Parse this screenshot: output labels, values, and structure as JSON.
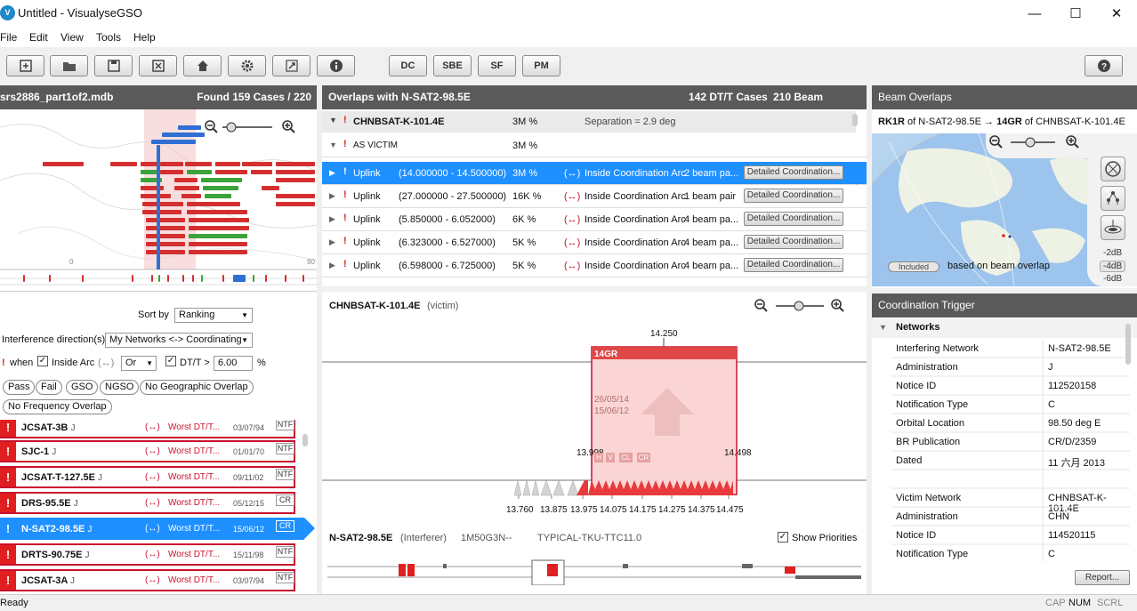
{
  "window": {
    "title": "Untitled - VisualyseGSO",
    "logo_text": "V"
  },
  "menu": [
    "File",
    "Edit",
    "View",
    "Tools",
    "Help"
  ],
  "toolbar": {
    "dc": "DC",
    "sbe": "SBE",
    "sf": "SF",
    "pm": "PM"
  },
  "left": {
    "header_file": "srs2886_part1of2.mdb",
    "header_found": "Found 159 Cases / 220",
    "map_ticks": {
      "t0": "0",
      "t90": "90"
    },
    "sort_label": "Sort by",
    "sort_value": "Ranking",
    "direction_label": "Interference direction(s)",
    "direction_value": "My Networks <-> Coordinating",
    "when_label": "when",
    "inside_arc": "Inside Arc",
    "arrow_sym": "(↔)",
    "or_value": "Or",
    "dt_label": "DT/T >",
    "dt_value": "6.00",
    "pct": "%",
    "pills": [
      "Pass",
      "Fail",
      "GSO",
      "NGSO",
      "No Geographic Overlap",
      "No Frequency Overlap"
    ],
    "cases": [
      {
        "name": "JCSAT-3B",
        "suffix": "J",
        "worst": "Worst DT/T...",
        "date": "03/07/94",
        "tag": "NTF"
      },
      {
        "name": "SJC-1",
        "suffix": "J",
        "worst": "Worst DT/T...",
        "date": "01/01/70",
        "tag": "NTF"
      },
      {
        "name": "JCSAT-T-127.5E",
        "suffix": "J",
        "worst": "Worst DT/T...",
        "date": "09/11/02",
        "tag": "NTF"
      },
      {
        "name": "DRS-95.5E",
        "suffix": "J",
        "worst": "Worst DT/T...",
        "date": "05/12/15",
        "tag": "CR"
      },
      {
        "name": "N-SAT2-98.5E",
        "suffix": "J",
        "worst": "Worst DT/T...",
        "date": "15/06/12",
        "tag": "CR"
      },
      {
        "name": "DRTS-90.75E",
        "suffix": "J",
        "worst": "Worst DT/T...",
        "date": "15/11/98",
        "tag": "NTF"
      },
      {
        "name": "JCSAT-3A",
        "suffix": "J",
        "worst": "Worst DT/T...",
        "date": "03/07/94",
        "tag": "NTF"
      }
    ],
    "excl": "!"
  },
  "mid": {
    "header_title": "Overlaps with N-SAT2-98.5E",
    "header_cases": "142 DT/T Cases",
    "header_beams": "210 Beam Overlaps",
    "group_name": "CHNBSAT-K-101.4E",
    "group_pct": "3M %",
    "group_sep": "Separation = 2.9 deg",
    "victim_label": "AS VICTIM",
    "victim_pct": "3M %",
    "rows": [
      {
        "dir": "Uplink",
        "range": "(14.000000 - 14.500000)",
        "pct": "3M %",
        "arc": "Inside Coordination Arc",
        "beams": "2 beam pa...",
        "btn": "Detailed Coordination..."
      },
      {
        "dir": "Uplink",
        "range": "(27.000000 - 27.500000)",
        "pct": "16K %",
        "arc": "Inside Coordination Arc",
        "beams": "1 beam pair",
        "btn": "Detailed Coordination..."
      },
      {
        "dir": "Uplink",
        "range": "(5.850000 - 6.052000)",
        "pct": "6K %",
        "arc": "Inside Coordination Arc",
        "beams": "4 beam pa...",
        "btn": "Detailed Coordination..."
      },
      {
        "dir": "Uplink",
        "range": "(6.323000 - 6.527000)",
        "pct": "5K %",
        "arc": "Inside Coordination Arc",
        "beams": "4 beam pa...",
        "btn": "Detailed Coordination..."
      },
      {
        "dir": "Uplink",
        "range": "(6.598000 - 6.725000)",
        "pct": "5K %",
        "arc": "Inside Coordination Arc",
        "beams": "4 beam pa...",
        "btn": "Detailed Coordination..."
      }
    ],
    "victim_net": "CHNBSAT-K-101.4E",
    "victim_tag": "(victim)",
    "freq_top": "14.250",
    "beam_label": "14GR",
    "dates": "26/05/14\n15/06/12",
    "date1": "26/05/14",
    "date2": "15/06/12",
    "left_edge": "13.998",
    "right_edge": "14.498",
    "badges": [
      "H",
      "V",
      "CL",
      "CR"
    ],
    "xticks": [
      "13.760",
      "13.875",
      "13.975",
      "14.075",
      "14.175",
      "14.275",
      "14.375",
      "14.475"
    ],
    "interferer": "N-SAT2-98.5E",
    "interferer_tag": "(Interferer)",
    "emission": "1M50G3N--",
    "antenna": "TYPICAL-TKU-TTC11.0",
    "show_priorities": "Show Priorities"
  },
  "right": {
    "header": "Beam Overlaps",
    "pair_a": "RK1R",
    "pair_a_of": "of N-SAT2-98.5E",
    "pair_b": "14GR",
    "pair_b_of": "of CHNBSAT-K-101.4E",
    "included": "Included",
    "based": "based on beam overlap",
    "db": [
      "-2dB",
      "-4dB",
      "-6dB"
    ],
    "trigger_header": "Coordination Trigger",
    "networks_label": "Networks",
    "kv": [
      {
        "k": "Interfering Network",
        "v": "N-SAT2-98.5E"
      },
      {
        "k": "Administration",
        "v": "J"
      },
      {
        "k": "Notice ID",
        "v": "112520158"
      },
      {
        "k": "Notification Type",
        "v": "C"
      },
      {
        "k": "Orbital Location",
        "v": "98.50 deg E"
      },
      {
        "k": "BR Publication",
        "v": "CR/D/2359"
      },
      {
        "k": "Dated",
        "v": "11 六月 2013"
      },
      {
        "k": "",
        "v": ""
      },
      {
        "k": "Victim Network",
        "v": "CHNBSAT-K-101.4E"
      },
      {
        "k": "Administration",
        "v": "CHN"
      },
      {
        "k": "Notice ID",
        "v": "114520115"
      },
      {
        "k": "Notification Type",
        "v": "C"
      }
    ],
    "report_btn": "Report..."
  },
  "status": {
    "left": "Ready",
    "cap": "CAP",
    "num": "NUM",
    "scrl": "SCRL"
  }
}
